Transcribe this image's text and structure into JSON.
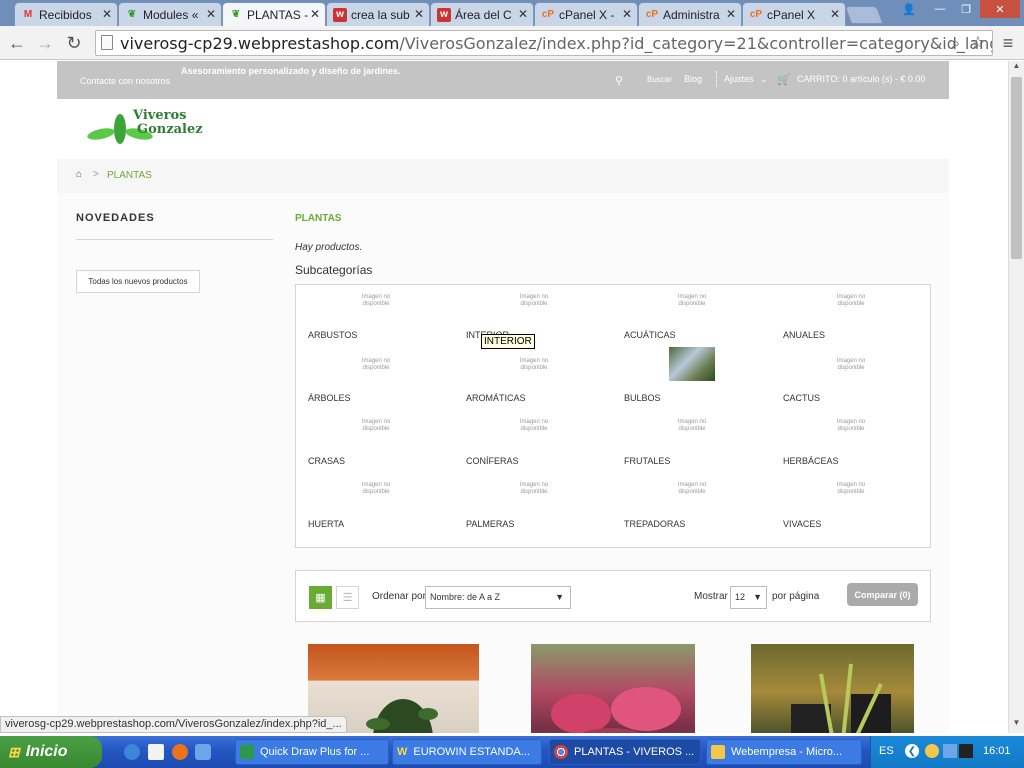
{
  "browser": {
    "tabs": [
      {
        "label": "Recibidos",
        "icon": "gmail-icon"
      },
      {
        "label": "Modules «",
        "icon": "leaf-icon"
      },
      {
        "label": "PLANTAS -",
        "icon": "leaf-icon"
      },
      {
        "label": "crea la sub",
        "icon": "w-icon"
      },
      {
        "label": "Área del C",
        "icon": "w-icon"
      },
      {
        "label": "cPanel X -",
        "icon": "cpanel-icon"
      },
      {
        "label": "Administra",
        "icon": "cpanel-icon"
      },
      {
        "label": "cPanel X",
        "icon": "cpanel-icon"
      }
    ],
    "url_host": "viverosg-cp29.webprestashop.com",
    "url_path": "/ViverosGonzalez/index.php?id_category=21&controller=category&id_lang=1",
    "status_url": "viverosg-cp29.webprestashop.com/ViverosGonzalez/index.php?id_..."
  },
  "site": {
    "header": {
      "contact": "Contacte con nosotros",
      "tagline": "Asesoramiento personalizado y diseño de jardines.",
      "search": "Buscar",
      "blog": "Blog",
      "settings": "Ajustes",
      "cart": "CARRITO: 0 artículo (s) - € 0.00"
    },
    "logo": {
      "line1": "Viveros",
      "line2": "Gonzalez"
    },
    "breadcrumb": {
      "current": "PLANTAS"
    },
    "sidebar": {
      "title": "NOVEDADES",
      "button": "Todas los nuevos productos"
    },
    "main": {
      "title": "PLANTAS",
      "products_text": "Hay productos.",
      "subcategories_title": "Subcategorías",
      "no_image_text": "Imagen no disponible",
      "tooltip": "INTERIOR",
      "subcategories": [
        "ARBUSTOS",
        "INTERIOR",
        "ACUÁTICAS",
        "ANUALES",
        "ÁRBOLES",
        "AROMÁTICAS",
        "BULBOS",
        "CACTUS",
        "CRASAS",
        "CONÍFERAS",
        "FRUTALES",
        "HERBÁCEAS",
        "HUERTA",
        "PALMERAS",
        "TREPADORAS",
        "VIVACES"
      ]
    },
    "sort": {
      "label": "Ordenar por",
      "value": "Nombre: de A a Z",
      "show_label": "Mostrar",
      "show_value": "12",
      "per_page": "por página",
      "compare": "Comparar (0)"
    },
    "accent_color": "#6aab34"
  },
  "taskbar": {
    "start": "Inicio",
    "items": [
      {
        "label": "Quick Draw Plus for ..."
      },
      {
        "label": "EUROWIN ESTANDA..."
      },
      {
        "label": "PLANTAS - VIVEROS ..."
      },
      {
        "label": "Webempresa - Micro..."
      }
    ],
    "lang": "ES",
    "time": "16:01"
  }
}
